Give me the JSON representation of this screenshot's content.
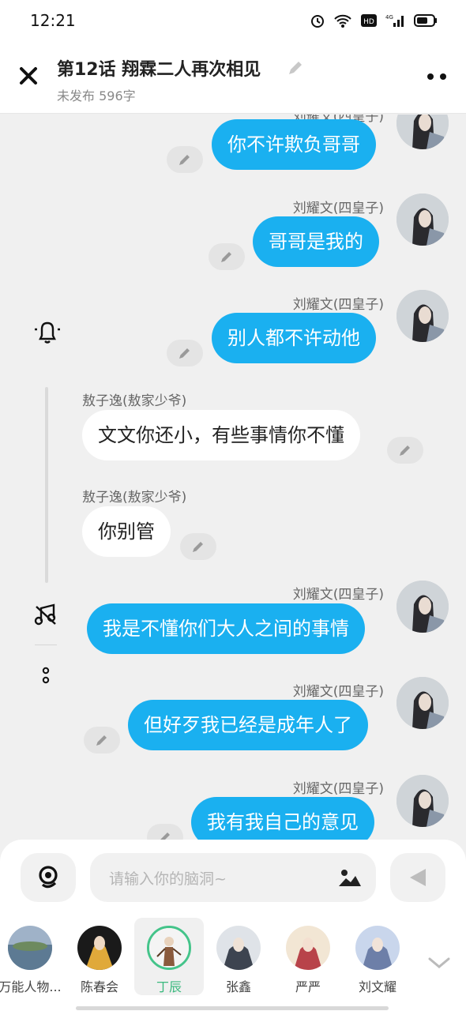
{
  "status": {
    "time": "12:21",
    "hd_label": "HD",
    "network_label": "4G"
  },
  "header": {
    "title": "第12话  翔霖二人再次相见",
    "subtitle": "未发布 596字"
  },
  "messages": [
    {
      "sender": "刘耀文(四皇子)",
      "text": "你不许欺负哥哥",
      "side": "right"
    },
    {
      "sender": "刘耀文(四皇子)",
      "text": "哥哥是我的",
      "side": "right"
    },
    {
      "sender": "刘耀文(四皇子)",
      "text": "别人都不许动他",
      "side": "right"
    },
    {
      "sender": "敖子逸(敖家少爷)",
      "text": "文文你还小，有些事情你不懂",
      "side": "left"
    },
    {
      "sender": "敖子逸(敖家少爷)",
      "text": "你别管",
      "side": "left"
    },
    {
      "sender": "刘耀文(四皇子)",
      "text": "我是不懂你们大人之间的事情",
      "side": "right"
    },
    {
      "sender": "刘耀文(四皇子)",
      "text": "但好歹我已经是成年人了",
      "side": "right"
    },
    {
      "sender": "刘耀文(四皇子)",
      "text": "我有我自己的意见",
      "side": "right"
    }
  ],
  "input": {
    "placeholder": "请输入你的脑洞~"
  },
  "characters": [
    {
      "name": "万能人物...",
      "color": "#7a93ad",
      "active": false
    },
    {
      "name": "陈春会",
      "color": "#d9a23a",
      "active": false
    },
    {
      "name": "丁辰",
      "color": "#8a5a3c",
      "active": true
    },
    {
      "name": "张鑫",
      "color": "#3d4450",
      "active": false
    },
    {
      "name": "严严",
      "color": "#b8434a",
      "active": false
    },
    {
      "name": "刘文耀",
      "color": "#6d7fa8",
      "active": false
    }
  ],
  "colors": {
    "accent": "#1ab0f0",
    "active_char": "#3cb97f"
  }
}
